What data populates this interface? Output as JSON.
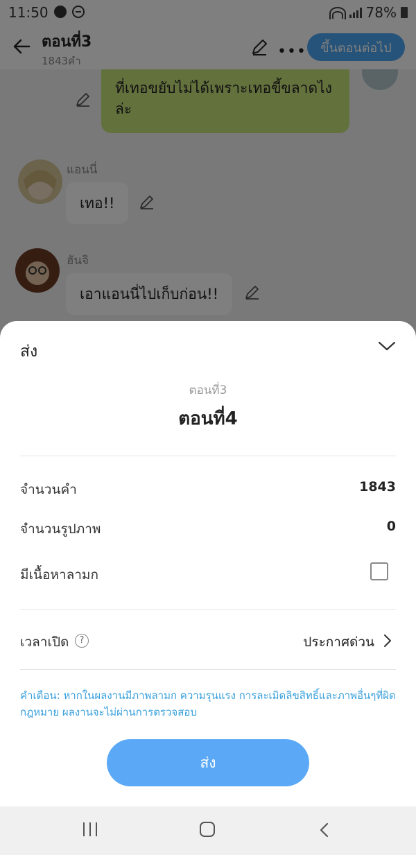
{
  "status_bar": {
    "time": "11:50",
    "battery": "78%"
  },
  "header": {
    "title": "ตอนที่3",
    "subtitle": "1843คำ",
    "next_button": "ขึ้นตอนต่อไป"
  },
  "chat": {
    "right_message": "ที่เทอขยับไม่ได้เพราะเทอขี้ขลาดไงล่ะ",
    "messages": [
      {
        "name": "แอนนี่",
        "text": "เทอ!!"
      },
      {
        "name": "ฮันจิ",
        "text": "เอาแอนนี่ไปเก็บก่อน!!"
      }
    ]
  },
  "sheet": {
    "title": "ส่ง",
    "previous_episode": "ตอนที่3",
    "current_episode": "ตอนที่4",
    "rows": {
      "word_count": {
        "label": "จำนวนคำ",
        "value": "1843"
      },
      "image_count": {
        "label": "จำนวนรูปภาพ",
        "value": "0"
      },
      "adult": {
        "label": "มีเนื้อหาลามก",
        "checked": false
      }
    },
    "publish_time": {
      "label": "เวลาเปิด",
      "help": "?",
      "value": "ประกาศด่วน"
    },
    "warning": "คำเตือน: หากในผลงานมีภาพลามก ความรุนแรง การละเมิดลิขสิทธิ์และภาพอื่นๆที่ผิดกฎหมาย ผลงานจะไม่ผ่านการตรวจสอบ",
    "send_button": "ส่ง"
  },
  "colors": {
    "accent": "#4aa6f3",
    "bubble_right": "#c6e27b",
    "warning": "#3aa0dc"
  }
}
